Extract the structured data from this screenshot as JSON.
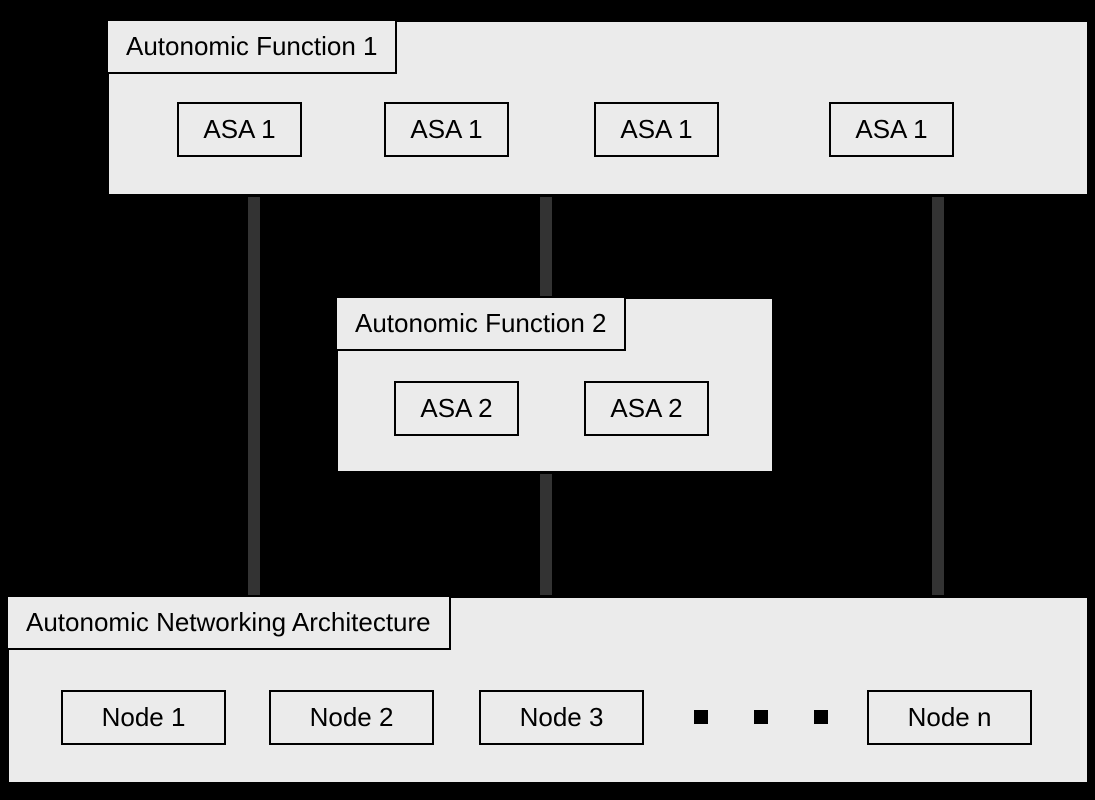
{
  "func1": {
    "title": "Autonomic Function 1",
    "cells": [
      "ASA 1",
      "ASA 1",
      "ASA 1",
      "ASA 1"
    ]
  },
  "func2": {
    "title": "Autonomic Function 2",
    "cells": [
      "ASA 2",
      "ASA 2"
    ]
  },
  "arch": {
    "title": "Autonomic Networking Architecture",
    "cells": [
      "Node 1",
      "Node 2",
      "Node 3",
      "Node n"
    ]
  }
}
